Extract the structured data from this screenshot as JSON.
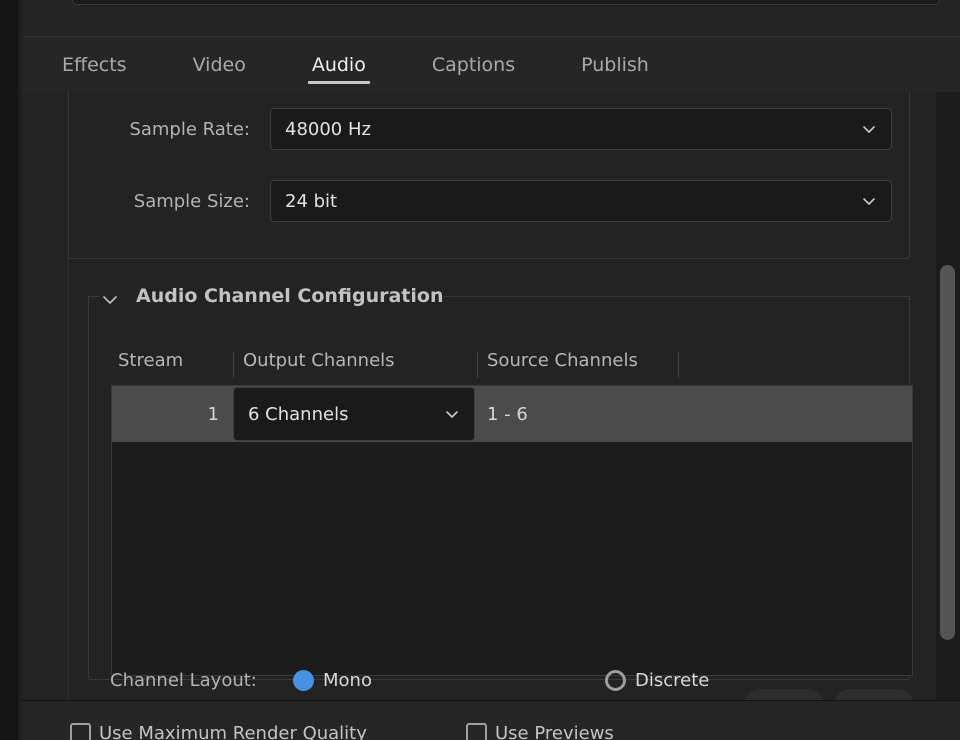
{
  "tabs": [
    {
      "label": "Effects",
      "active": false
    },
    {
      "label": "Video",
      "active": false
    },
    {
      "label": "Audio",
      "active": true
    },
    {
      "label": "Captions",
      "active": false
    },
    {
      "label": "Publish",
      "active": false
    }
  ],
  "audio_format": {
    "sample_rate": {
      "label": "Sample Rate:",
      "value": "48000 Hz"
    },
    "sample_size": {
      "label": "Sample Size:",
      "value": "24 bit"
    }
  },
  "channel_config": {
    "title": "Audio Channel Configuration",
    "expanded": true,
    "disclosure_icon": "chevron-down-icon",
    "columns": [
      "Stream",
      "Output Channels",
      "Source Channels"
    ],
    "rows": [
      {
        "stream": "1",
        "output_channels": "6 Channels",
        "source_channels": "1 - 6"
      }
    ],
    "add_label": "+",
    "remove_label": "-",
    "channel_layout": {
      "label": "Channel Layout:",
      "options": [
        {
          "label": "Mono",
          "selected": true
        },
        {
          "label": "Discrete",
          "selected": false
        }
      ]
    }
  },
  "footer": {
    "checkboxes": [
      {
        "label": "Use Maximum Render Quality",
        "checked": false
      },
      {
        "label": "Use Previews",
        "checked": false
      }
    ]
  },
  "colors": {
    "accent": "#4a90e2",
    "panel_bg": "#232323",
    "tabstrip_bg": "#262626",
    "field_bg": "#1a1a1a",
    "row_selected": "#4b4b4b",
    "scrollbar_thumb": "#555555"
  }
}
